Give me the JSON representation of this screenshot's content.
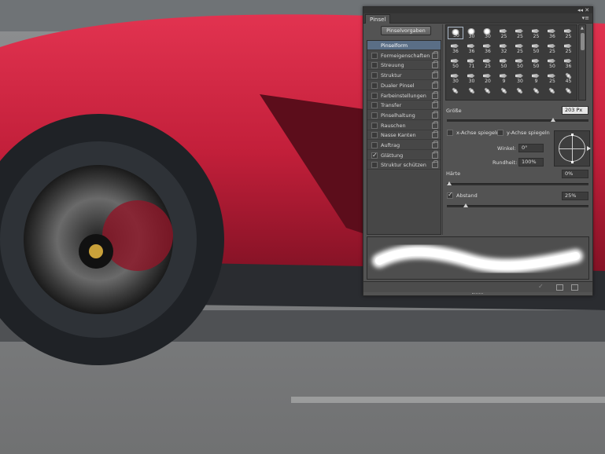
{
  "panel": {
    "tab_label": "Pinsel",
    "top_controls": "◂◂ ✕",
    "menu_icon": "▾≡",
    "preset_button_label": "Pinselvorgaben",
    "list_items": [
      {
        "label": "Pinselform",
        "checkbox": false,
        "checked": false,
        "lock": false,
        "selected": true
      },
      {
        "label": "Formeigenschaften",
        "checkbox": true,
        "checked": false,
        "lock": true,
        "selected": false
      },
      {
        "label": "Streuung",
        "checkbox": true,
        "checked": false,
        "lock": true,
        "selected": false
      },
      {
        "label": "Struktur",
        "checkbox": true,
        "checked": false,
        "lock": true,
        "selected": false
      },
      {
        "label": "Dualer Pinsel",
        "checkbox": true,
        "checked": false,
        "lock": true,
        "selected": false
      },
      {
        "label": "Farbeinstellungen",
        "checkbox": true,
        "checked": false,
        "lock": true,
        "selected": false
      },
      {
        "label": "Transfer",
        "checkbox": true,
        "checked": false,
        "lock": true,
        "selected": false
      },
      {
        "label": "Pinselhaltung",
        "checkbox": true,
        "checked": false,
        "lock": true,
        "selected": false
      },
      {
        "label": "Rauschen",
        "checkbox": true,
        "checked": false,
        "lock": true,
        "selected": false
      },
      {
        "label": "Nasse Kanten",
        "checkbox": true,
        "checked": false,
        "lock": true,
        "selected": false
      },
      {
        "label": "Auftrag",
        "checkbox": true,
        "checked": false,
        "lock": true,
        "selected": false
      },
      {
        "label": "Glättung",
        "checkbox": true,
        "checked": true,
        "lock": true,
        "selected": false
      },
      {
        "label": "Struktur schützen",
        "checkbox": true,
        "checked": false,
        "lock": true,
        "selected": false
      }
    ],
    "brush_rows": [
      [
        {
          "tip": "round",
          "n": "30"
        },
        {
          "tip": "round",
          "n": "30"
        },
        {
          "tip": "round",
          "n": "30"
        },
        {
          "tip": "arrow",
          "n": "25"
        },
        {
          "tip": "arrow",
          "n": "25"
        },
        {
          "tip": "arrow",
          "n": "25"
        },
        {
          "tip": "arrow",
          "n": "36"
        },
        {
          "tip": "arrow",
          "n": "25"
        }
      ],
      [
        {
          "tip": "arrow",
          "n": "36"
        },
        {
          "tip": "arrow",
          "n": "36"
        },
        {
          "tip": "arrow",
          "n": "36"
        },
        {
          "tip": "arrow",
          "n": "32"
        },
        {
          "tip": "arrow",
          "n": "25"
        },
        {
          "tip": "arrow",
          "n": "50"
        },
        {
          "tip": "arrow",
          "n": "25"
        },
        {
          "tip": "arrow",
          "n": "25"
        }
      ],
      [
        {
          "tip": "arrow",
          "n": "50"
        },
        {
          "tip": "arrow",
          "n": "71"
        },
        {
          "tip": "arrow",
          "n": "25"
        },
        {
          "tip": "arrow",
          "n": "50"
        },
        {
          "tip": "arrow",
          "n": "50"
        },
        {
          "tip": "arrow",
          "n": "50"
        },
        {
          "tip": "arrow",
          "n": "50"
        },
        {
          "tip": "arrow",
          "n": "36"
        }
      ],
      [
        {
          "tip": "arrow",
          "n": "30"
        },
        {
          "tip": "arrow",
          "n": "30"
        },
        {
          "tip": "arrow",
          "n": "20"
        },
        {
          "tip": "arrow",
          "n": "9"
        },
        {
          "tip": "arrow",
          "n": "30"
        },
        {
          "tip": "arrow",
          "n": "9"
        },
        {
          "tip": "arrow",
          "n": "25"
        },
        {
          "tip": "scatter",
          "n": "45"
        }
      ],
      [
        {
          "tip": "scatter",
          "n": ""
        },
        {
          "tip": "scatter",
          "n": ""
        },
        {
          "tip": "scatter",
          "n": ""
        },
        {
          "tip": "scatter",
          "n": ""
        },
        {
          "tip": "scatter",
          "n": ""
        },
        {
          "tip": "scatter",
          "n": ""
        },
        {
          "tip": "scatter",
          "n": ""
        },
        {
          "tip": "scatter",
          "n": ""
        }
      ]
    ],
    "size_label": "Größe",
    "size_value": "203 Px",
    "size_slider_fraction": 0.76,
    "flip_x_label": "x-Achse spiegeln",
    "flip_y_label": "y-Achse spiegeln",
    "angle_label": "Winkel:",
    "angle_value": "0°",
    "roundness_label": "Rundheit:",
    "roundness_value": "100%",
    "hardness_label": "Härte",
    "hardness_value": "0%",
    "hardness_slider_fraction": 0.0,
    "spacing_label": "Abstand",
    "spacing_checked": true,
    "spacing_value": "25%",
    "spacing_slider_fraction": 0.12
  }
}
